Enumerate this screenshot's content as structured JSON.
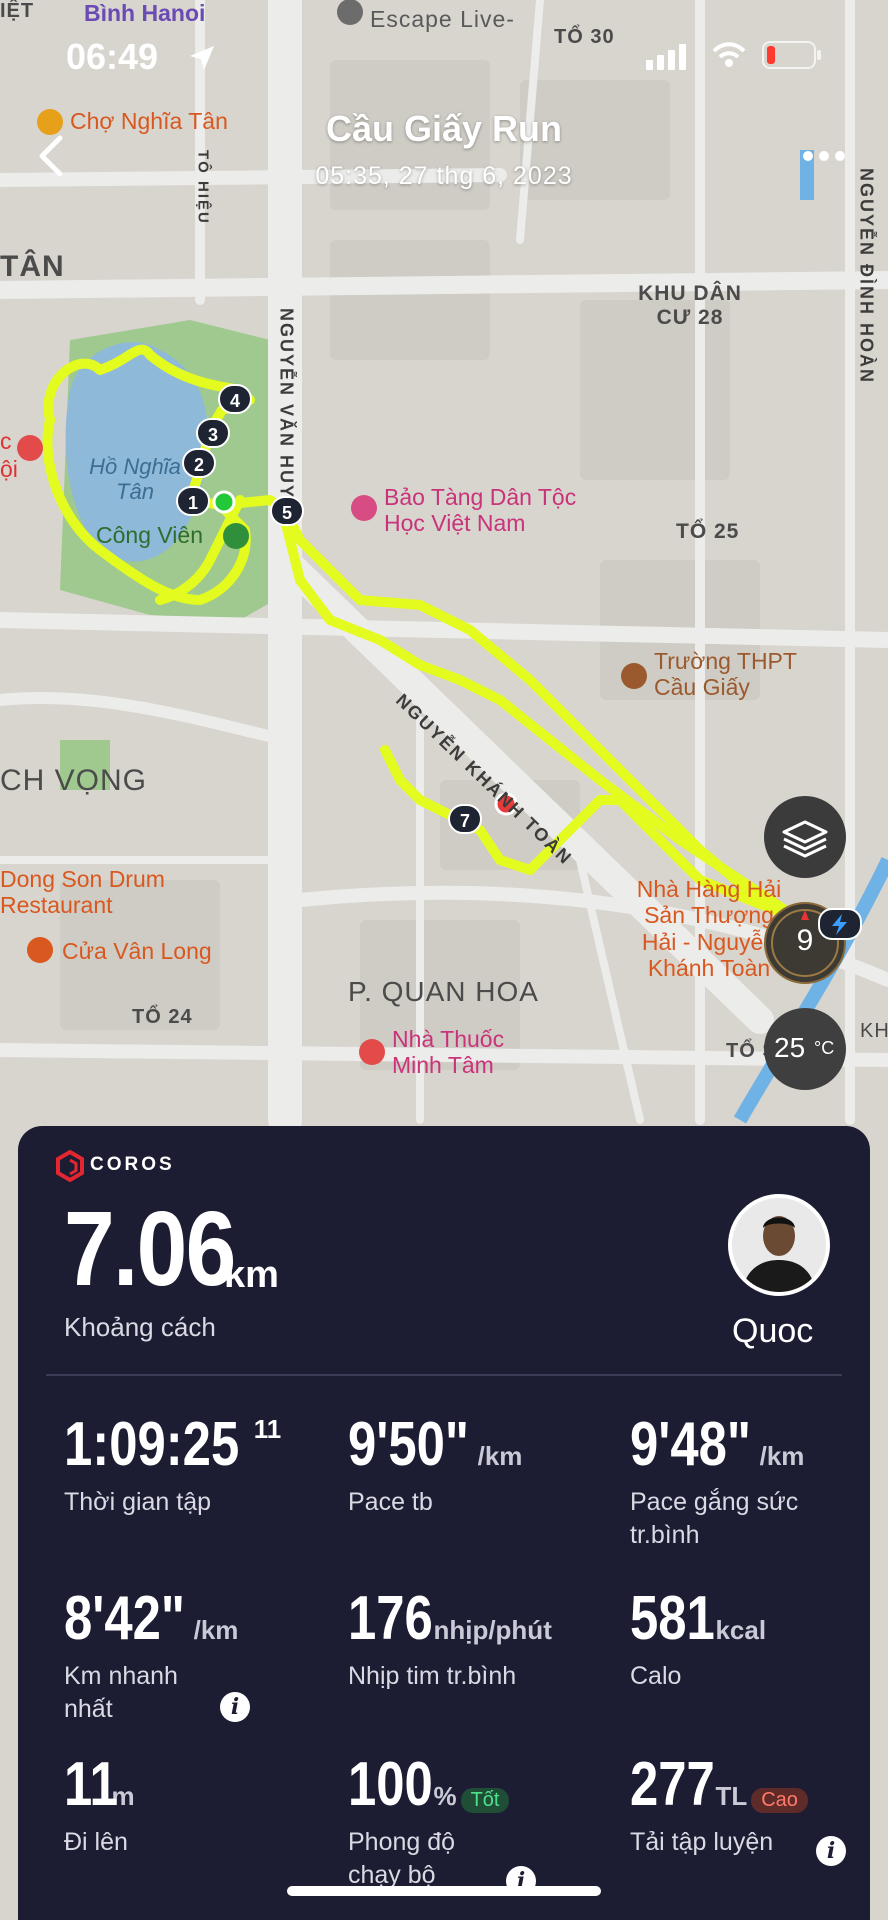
{
  "status_bar": {
    "time": "06:49"
  },
  "header": {
    "title": "Cầu Giấy Run",
    "subtitle": "05:35, 27 thg 6, 2023"
  },
  "map_labels": {
    "top_left_cut": "IỆT",
    "binh_hanoi": "Bình Hanoi",
    "escape": "Escape Live-",
    "to30": "TỔ 30",
    "cho_nghia_tan": "Chợ Nghĩa Tân",
    "to_hieu": "TÔ HIỆU",
    "tan": "TÂN",
    "nguyen_van_huyen": "NGUYỄN VĂN HUYÊN",
    "khu_dan_cu": "KHU DÂN CƯ 28",
    "nguyen_dinh_hoan": "NGUYỄN ĐÌNH HOÀN",
    "ho_nghia_tan": "Hồ Nghĩa Tân",
    "cong_vien": "Công Viên",
    "bao_tang": "Bảo Tàng Dân Tộc Học Việt Nam",
    "to25": "TỔ 25",
    "nguyen_khanh_toan": "NGUYỄN KHÁNH TOÀN",
    "truong_thpt": "Trường THPT Cầu Giấy",
    "ch_vong": "CH VỌNG",
    "dong_son": "Dong Son Drum Restaurant",
    "cua_van_long": "Cửa Vân Long",
    "nha_hang": "Nhà Hàng Hải Sản Thượng Hải - Nguyễn Khánh Toàn",
    "quan_hoa": "P. QUAN HOA",
    "to24": "TỔ 24",
    "nha_thuoc": "Nhà Thuốc Minh Tâm",
    "to_so": "TỔ SỐ",
    "left_c": "c",
    "left_oi": "ội",
    "right_kh": "KH"
  },
  "route_markers": [
    "1",
    "2",
    "3",
    "4",
    "5",
    "7"
  ],
  "map_controls": {
    "layers_icon": "layers-icon",
    "compass_value": "9",
    "temperature": "25",
    "temperature_unit": "°C"
  },
  "brand": "COROS",
  "summary": {
    "distance": "7.06",
    "distance_unit": "km",
    "distance_label": "Khoảng cách",
    "user_name": "Quoc"
  },
  "stats": {
    "time": {
      "value": "1:09:25",
      "sup": "11",
      "label": "Thời gian tập"
    },
    "pace_avg": {
      "value": "9'50\"",
      "unit": "/km",
      "label": "Pace tb"
    },
    "pace_effort": {
      "value": "9'48\"",
      "unit": "/km",
      "label": "Pace gắng sức tr.bình"
    },
    "fastest_km": {
      "value": "8'42\"",
      "unit": "/km",
      "label": "Km nhanh nhất"
    },
    "heart_rate": {
      "value": "176",
      "unit": "nhịp/phút",
      "label": "Nhịp tim tr.bình"
    },
    "calories": {
      "value": "581",
      "unit": "kcal",
      "label": "Calo"
    },
    "elevation": {
      "value": "11",
      "unit": "m",
      "label": "Đi lên"
    },
    "running_form": {
      "value": "100",
      "unit": "%",
      "badge": "Tốt",
      "label": "Phong độ chạy bộ"
    },
    "training_load": {
      "value": "277",
      "unit": "TL",
      "badge": "Cao",
      "label": "Tải tập luyện"
    }
  },
  "colors": {
    "route": "#e3fb1e",
    "card_bg": "#1c1d33",
    "brand_red": "#e3262f",
    "good": "#4ee18a",
    "high": "#ff7a6a"
  }
}
